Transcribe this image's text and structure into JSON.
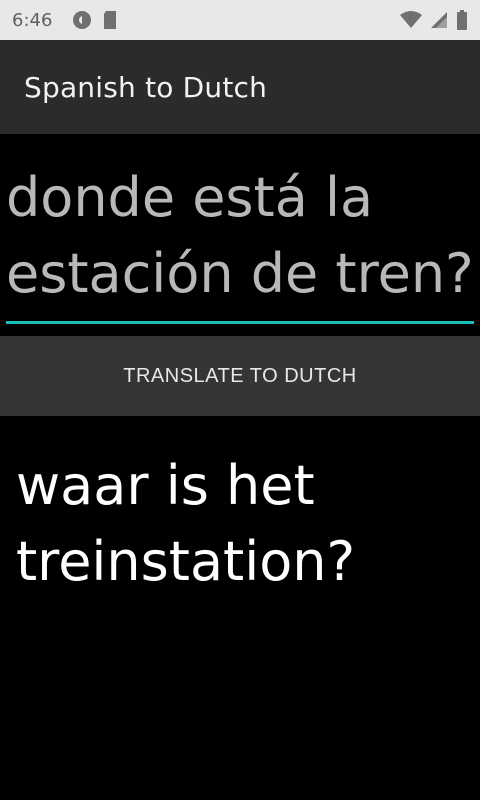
{
  "status_bar": {
    "time": "6:46",
    "left_icons": [
      "at-icon",
      "sd-card-icon"
    ],
    "right_icons": [
      "wifi-icon",
      "cellular-signal-icon",
      "battery-icon"
    ]
  },
  "app_bar": {
    "title": "Spanish to Dutch"
  },
  "input": {
    "value": "donde está la estación de tren?"
  },
  "translate_button": {
    "label": "TRANSLATE TO DUTCH"
  },
  "output": {
    "text": "waar is het treinstation?"
  },
  "colors": {
    "background": "#000000",
    "app_bar": "#2b2b2b",
    "accent_underline": "#19bfb8",
    "button": "#353535",
    "status_bar": "#e8e8e8"
  }
}
